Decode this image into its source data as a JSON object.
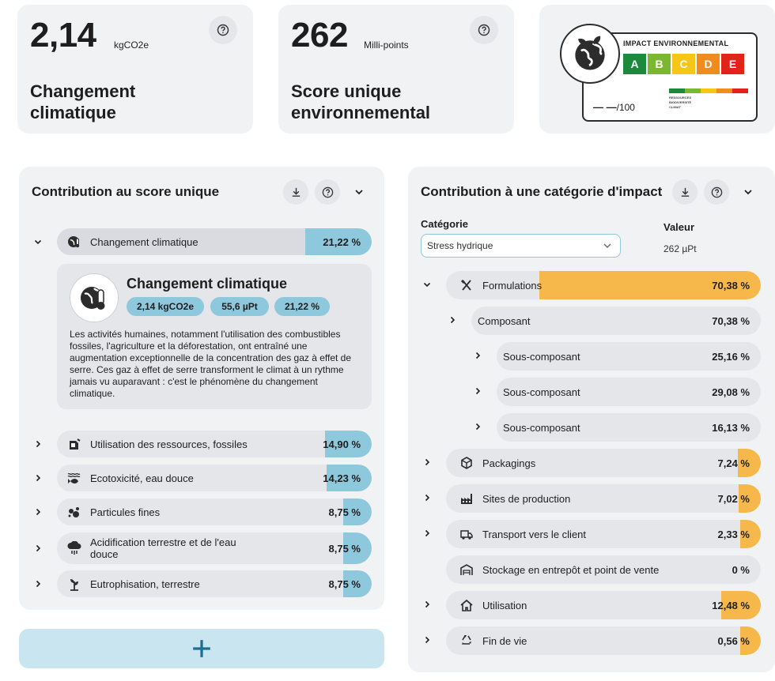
{
  "kpis": [
    {
      "value": "2,14",
      "unit": "kgCO2e",
      "label_line1": "Changement",
      "label_line2": "climatique"
    },
    {
      "value": "262",
      "unit": "Milli-points",
      "label_line1": "Score unique",
      "label_line2": "environnemental"
    }
  ],
  "eco_label": {
    "title": "IMPACT ENVIRONNEMENTAL",
    "grades": [
      "A",
      "B",
      "C",
      "D",
      "E"
    ],
    "grade_colors": [
      "#1b8a3c",
      "#7cb82f",
      "#f5c518",
      "#f08c1e",
      "#e2231a"
    ],
    "score": "— —",
    "score_suffix": "/100",
    "mini_labels": [
      "RESSOURCES",
      "BIODIVERSITÉ",
      "CLIMAT"
    ]
  },
  "left_panel": {
    "title": "Contribution au score unique",
    "expanded_row": {
      "icon": "globe-thermometer-icon",
      "label": "Changement climatique",
      "pct": "21,22 %",
      "fill": 0.21
    },
    "detail": {
      "title": "Changement climatique",
      "chips": [
        "2,14 kgCO2e",
        "55,6 µPt",
        "21,22 %"
      ],
      "text": "Les activités humaines, notamment l'utilisation des combustibles fossiles, l'agriculture et la déforestation, ont entraîné une augmentation exceptionnelle de la concentration des gaz à effet de serre. Ces gaz à effet de serre transforment le climat à un rythme jamais vu auparavant : c'est le phénomène du changement climatique."
    },
    "rows": [
      {
        "icon": "fuel-can-icon",
        "label": "Utilisation des ressources, fossiles",
        "pct": "14,90 %",
        "fill": 0.149
      },
      {
        "icon": "fish-water-icon",
        "label": "Ecotoxicité, eau douce",
        "pct": "14,23 %",
        "fill": 0.142
      },
      {
        "icon": "particles-icon",
        "label": "Particules fines",
        "pct": "8,75 %",
        "fill": 0.0875
      },
      {
        "icon": "acid-rain-icon",
        "label": "Acidification terrestre et de l'eau douce",
        "pct": "8,75 %",
        "fill": 0.0875
      },
      {
        "icon": "plant-icon",
        "label": "Eutrophisation, terrestre",
        "pct": "8,75 %",
        "fill": 0.0875
      }
    ],
    "add_label": "+"
  },
  "right_panel": {
    "title": "Contribution à une catégorie d'impact",
    "category_label": "Catégorie",
    "category_value": "Stress hydrique",
    "value_label": "Valeur",
    "value": "262 µPt",
    "rows": [
      {
        "level": 0,
        "chevron": "down",
        "icon": "utensils-icon",
        "label": "Formulations",
        "pct": "70,38 %",
        "fill": 0.7038
      },
      {
        "level": 1,
        "chevron": "right",
        "icon": "",
        "label": "Composant",
        "pct": "70,38 %",
        "fill": 0
      },
      {
        "level": 2,
        "chevron": "right",
        "icon": "",
        "label": "Sous-composant",
        "pct": "25,16 %",
        "fill": 0
      },
      {
        "level": 2,
        "chevron": "right",
        "icon": "",
        "label": "Sous-composant",
        "pct": "29,08 %",
        "fill": 0
      },
      {
        "level": 2,
        "chevron": "right",
        "icon": "",
        "label": "Sous-composant",
        "pct": "16,13 %",
        "fill": 0
      },
      {
        "level": 0,
        "chevron": "right",
        "icon": "box-icon",
        "label": "Packagings",
        "pct": "7,24 %",
        "fill": 0.0724
      },
      {
        "level": 0,
        "chevron": "right",
        "icon": "factory-icon",
        "label": "Sites de production",
        "pct": "7,02 %",
        "fill": 0.0702
      },
      {
        "level": 0,
        "chevron": "right",
        "icon": "truck-icon",
        "label": "Transport vers le client",
        "pct": "2,33 %",
        "fill": 0.0233
      },
      {
        "level": 0,
        "chevron": "",
        "icon": "warehouse-icon",
        "label": "Stockage en entrepôt et point de vente",
        "pct": "0 %",
        "fill": 0
      },
      {
        "level": 0,
        "chevron": "right",
        "icon": "home-icon",
        "label": "Utilisation",
        "pct": "12,48 %",
        "fill": 0.1248
      },
      {
        "level": 0,
        "chevron": "right",
        "icon": "recycle-icon",
        "label": "Fin de vie",
        "pct": "0,56 %",
        "fill": 0.0056
      }
    ]
  },
  "colors": {
    "blue_fill": "#8ec8dc",
    "orange_fill": "#f6b84a",
    "card_bg": "#f1f2f4",
    "row_bg": "#e4e6ea"
  }
}
